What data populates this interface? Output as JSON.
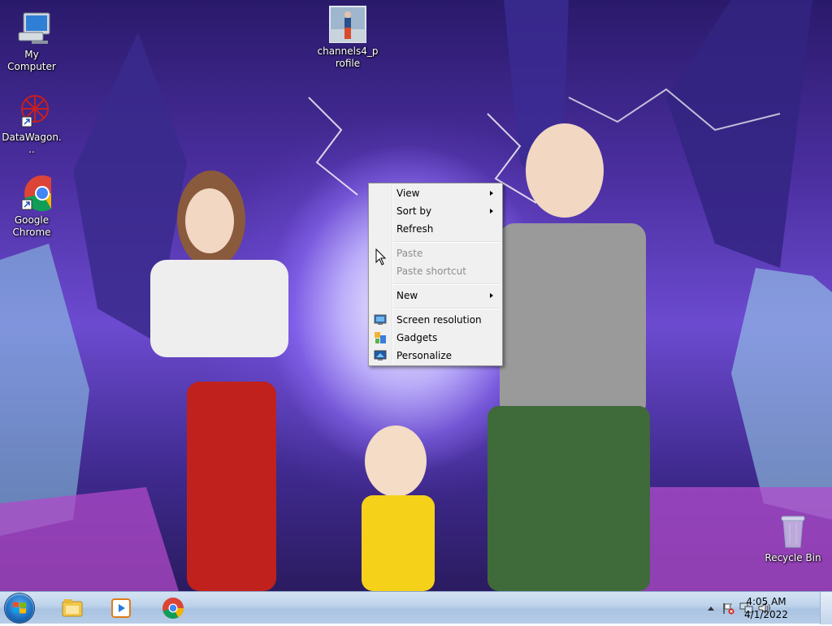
{
  "desktop": {
    "icons": [
      {
        "label": "My Computer",
        "icon": "computer-icon"
      },
      {
        "label": "DataWagon...",
        "icon": "datawagon-icon"
      },
      {
        "label": "Google Chrome",
        "icon": "chrome-icon"
      },
      {
        "label": "channels4_profile",
        "icon": "image-file-icon"
      },
      {
        "label": "Recycle Bin",
        "icon": "recycle-bin-icon"
      }
    ]
  },
  "context_menu": {
    "items": [
      {
        "label": "View",
        "submenu": true,
        "disabled": false
      },
      {
        "label": "Sort by",
        "submenu": true,
        "disabled": false
      },
      {
        "label": "Refresh",
        "submenu": false,
        "disabled": false
      },
      {
        "label": "Paste",
        "submenu": false,
        "disabled": true
      },
      {
        "label": "Paste shortcut",
        "submenu": false,
        "disabled": true
      },
      {
        "label": "New",
        "submenu": true,
        "disabled": false
      },
      {
        "label": "Screen resolution",
        "icon": "screen-resolution-icon",
        "disabled": false
      },
      {
        "label": "Gadgets",
        "icon": "gadgets-icon",
        "disabled": false
      },
      {
        "label": "Personalize",
        "icon": "personalize-icon",
        "disabled": false
      }
    ]
  },
  "taskbar": {
    "pinned": [
      {
        "icon": "file-explorer-icon"
      },
      {
        "icon": "media-player-icon"
      },
      {
        "icon": "chrome-icon"
      }
    ],
    "tray": {
      "icons": [
        "show-hidden-icons-chevron",
        "action-center-flag-icon",
        "network-icon",
        "volume-icon"
      ]
    },
    "clock": {
      "time": "4:05 AM",
      "date": "4/1/2022"
    }
  },
  "colors": {
    "menu_bg": "#f0f0f0",
    "menu_disabled_text": "#8d8d8d",
    "taskbar": "#bcd2ea"
  }
}
